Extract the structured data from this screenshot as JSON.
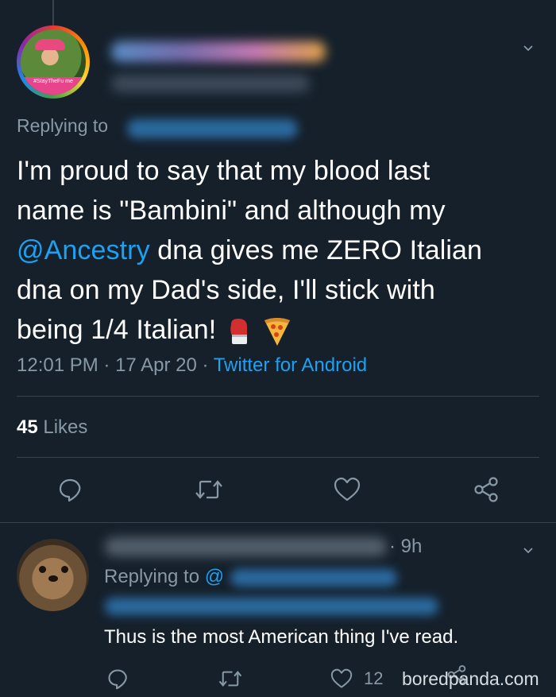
{
  "tweet": {
    "replying_label": "Replying to",
    "text_line1": "I'm proud to say that my blood last",
    "text_line2": "name is \"Bambini\" and although my",
    "mention": "@Ancestry",
    "text_line3_rest": " dna gives me ZERO Italian",
    "text_line4": "dna on my Dad's side, I'll stick with",
    "text_line5": "being 1/4 Italian! ",
    "emoji1": "boxing-glove",
    "emoji2": "pizza",
    "time": "12:01 PM",
    "sep1": " · ",
    "date": "17 Apr 20",
    "sep2": " · ",
    "source": "Twitter for Android",
    "likes_count": "45",
    "likes_label": " Likes",
    "avatar_band_text": "#StayTheFu    me"
  },
  "actions": [
    "reply-icon",
    "retweet-icon",
    "like-icon",
    "share-icon"
  ],
  "reply": {
    "time": "· 9h",
    "replying_label": "Replying to",
    "replying_handle_partial": "@",
    "text": "Thus is the most American thing I've read.",
    "like_count": "12",
    "watermark": "boredpanda.com"
  },
  "colors": {
    "background": "#15202b",
    "accent": "#1da1f2",
    "muted": "#8899a6",
    "divider": "#38444d"
  }
}
